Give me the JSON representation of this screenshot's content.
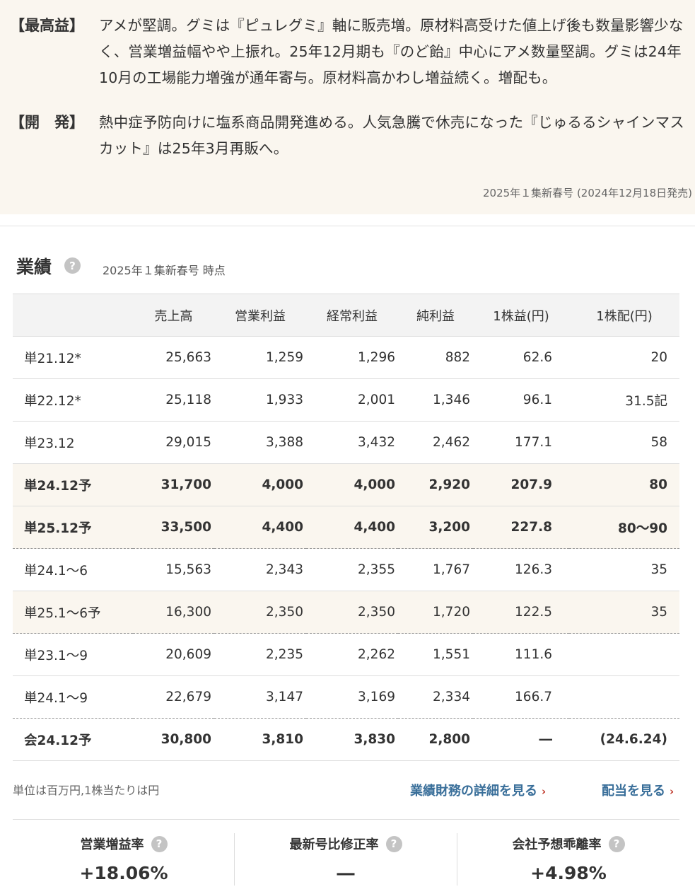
{
  "comments": {
    "profit_tag": "【最高益】",
    "profit_text": "アメが堅調。グミは『ピュレグミ』軸に販売増。原材料高受けた値上げ後も数量影響少なく、営業増益幅やや上振れ。25年12月期も『のど飴』中心にアメ数量堅調。グミは24年10月の工場能力増強が通年寄与。原材料高かわし増益続く。増配も。",
    "dev_tag": "【開　発】",
    "dev_text": "熱中症予防向けに塩系商品開発進める。人気急騰で休売になった『じゅるるシャインマスカット』は25年3月再販へ。",
    "issue_note": "2025年１集新春号 (2024年12月18日発売)"
  },
  "section": {
    "title": "業績",
    "as_of": "2025年１集新春号 時点"
  },
  "table": {
    "headers": [
      "",
      "売上高",
      "営業利益",
      "経常利益",
      "純利益",
      "1株益(円)",
      "1株配(円)"
    ],
    "rows": [
      {
        "label": "単21.12*",
        "cells": [
          "25,663",
          "1,259",
          "1,296",
          "882",
          "62.6",
          "20"
        ]
      },
      {
        "label": "単22.12*",
        "cells": [
          "25,118",
          "1,933",
          "2,001",
          "1,346",
          "96.1",
          "31.5記"
        ]
      },
      {
        "label": "単23.12",
        "cells": [
          "29,015",
          "3,388",
          "3,432",
          "2,462",
          "177.1",
          "58"
        ]
      },
      {
        "label": "単24.12予",
        "cells": [
          "31,700",
          "4,000",
          "4,000",
          "2,920",
          "207.9",
          "80"
        ]
      },
      {
        "label": "単25.12予",
        "cells": [
          "33,500",
          "4,400",
          "4,400",
          "3,200",
          "227.8",
          "80～90"
        ]
      },
      {
        "label": "単24.1～6",
        "cells": [
          "15,563",
          "2,343",
          "2,355",
          "1,767",
          "126.3",
          "35"
        ]
      },
      {
        "label": "単25.1～6予",
        "cells": [
          "16,300",
          "2,350",
          "2,350",
          "1,720",
          "122.5",
          "35"
        ]
      },
      {
        "label": "単23.1～9",
        "cells": [
          "20,609",
          "2,235",
          "2,262",
          "1,551",
          "111.6",
          ""
        ]
      },
      {
        "label": "単24.1～9",
        "cells": [
          "22,679",
          "3,147",
          "3,169",
          "2,334",
          "166.7",
          ""
        ]
      },
      {
        "label": "会24.12予",
        "cells": [
          "30,800",
          "3,810",
          "3,830",
          "2,800",
          "―",
          "(24.6.24)"
        ]
      }
    ]
  },
  "footer": {
    "unit_note": "単位は百万円,1株当たりは円",
    "link_detail": "業績財務の詳細を見る",
    "link_dividend": "配当を見る",
    "chevron": "›"
  },
  "metrics": [
    {
      "label": "営業増益率",
      "value": "+18.06%"
    },
    {
      "label": "最新号比修正率",
      "value": "―"
    },
    {
      "label": "会社予想乖離率",
      "value": "+4.98%"
    }
  ],
  "help_glyph": "?"
}
